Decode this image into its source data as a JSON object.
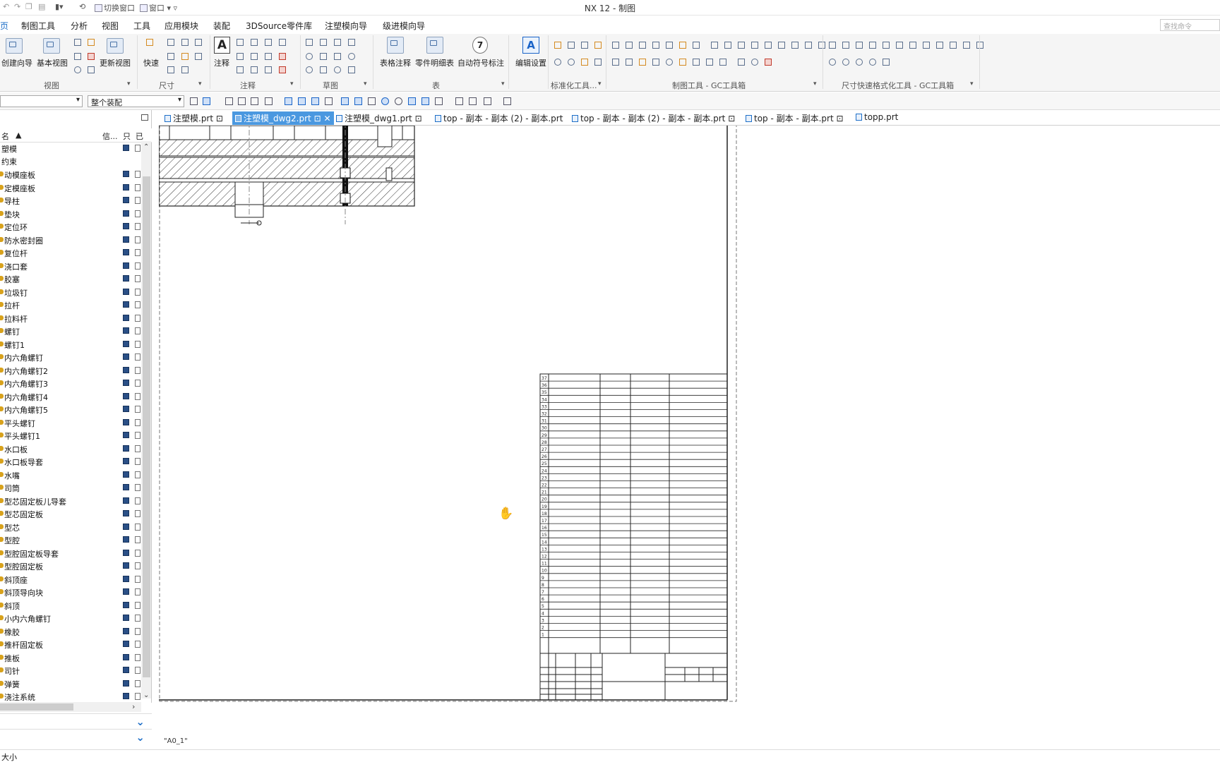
{
  "window": {
    "title": "NX 12 - 制图"
  },
  "quick_access": {
    "switch_window": "切换窗口",
    "window": "窗口"
  },
  "menu": {
    "items": [
      "页",
      "制图工具",
      "分析",
      "视图",
      "工具",
      "装配",
      "3DSource零件库",
      "注塑模向导",
      "级进模向导"
    ],
    "active": "页"
  },
  "search": {
    "placeholder": "查找命令"
  },
  "ribbon": {
    "buttons": {
      "drawing_wizard": "创建向导",
      "base_view": "基本视图",
      "update_view": "更新视图",
      "quick": "快速",
      "note": "注释",
      "table_note": "表格注释",
      "parts_list": "零件明细表",
      "auto_balloon": "自动符号标注",
      "edit_settings": "编辑设置"
    },
    "groups": {
      "view": "视图",
      "dimension": "尺寸",
      "annotation": "注释",
      "sketch": "草图",
      "table": "表",
      "standard": "标准化工具...",
      "gc_drafting": "制图工具 - GC工具箱",
      "gc_dim_format": "尺寸快速格式化工具 - GC工具箱"
    }
  },
  "toolbar": {
    "assembly_scope": "整个装配"
  },
  "navigator": {
    "columns": {
      "name": "名",
      "info": "信...",
      "c3": "只",
      "c4": "已"
    },
    "root": "塑模",
    "constraints": "约束",
    "parts": [
      "动模座板",
      "定模座板",
      "导柱",
      "垫块",
      "定位环",
      "防水密封圈",
      "复位杆",
      "浇口套",
      "胶塞",
      "垃圾钉",
      "拉杆",
      "拉料杆",
      "螺钉",
      "螺钉1",
      "内六角螺钉",
      "内六角螺钉2",
      "内六角螺钉3",
      "内六角螺钉4",
      "内六角螺钉5",
      "平头螺钉",
      "平头螺钉1",
      "水口板",
      "水口板导套",
      "水嘴",
      "司筒",
      "型芯固定板儿导套",
      "型芯固定板",
      "型芯",
      "型腔",
      "型腔固定板导套",
      "型腔固定板",
      "斜顶座",
      "斜顶导向块",
      "斜顶",
      "小内六角螺钉",
      "橡胶",
      "推杆固定板",
      "推板",
      "司针",
      "弹簧",
      "浇注系统"
    ]
  },
  "tabs": [
    {
      "label": "注塑模.prt",
      "active": false
    },
    {
      "label": "注塑模_dwg2.prt",
      "active": true
    },
    {
      "label": "注塑模_dwg1.prt",
      "active": false
    },
    {
      "label": "top - 副本 - 副本 (2) - 副本.prt",
      "active": false
    },
    {
      "label": "top - 副本 - 副本 (2) - 副本 - 副本.prt",
      "active": false
    },
    {
      "label": "top - 副本 - 副本.prt",
      "active": false
    },
    {
      "label": "topp.prt",
      "active": false
    }
  ],
  "drawing": {
    "sheet_name": "\"A0_1\"",
    "parts_list_rows": [
      "37",
      "36",
      "35",
      "34",
      "33",
      "32",
      "31",
      "30",
      "29",
      "28",
      "27",
      "26",
      "25",
      "24",
      "23",
      "22",
      "21",
      "20",
      "19",
      "18",
      "17",
      "16",
      "15",
      "14",
      "13",
      "12",
      "11",
      "10",
      "9",
      "8",
      "7",
      "6",
      "5",
      "4",
      "3",
      "2",
      "1"
    ]
  },
  "status": {
    "text": "大小"
  },
  "colors": {
    "accent": "#1e6fc8",
    "active_tab": "#4a98e0",
    "ribbon_bg": "#f5f5f5"
  }
}
